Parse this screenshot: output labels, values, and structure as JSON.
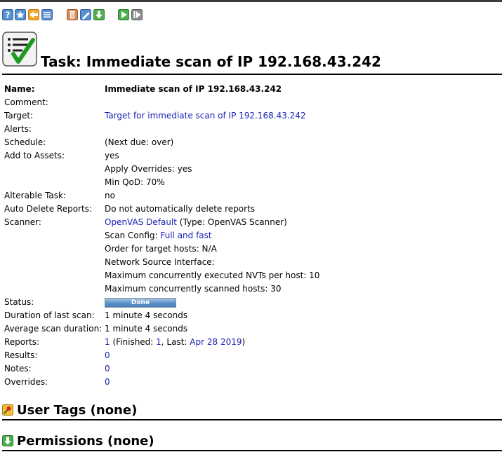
{
  "colors": {
    "link": "#1a22b4",
    "progress": "#5b8fc7"
  },
  "toolbar": {
    "icons": [
      "help-icon",
      "new-task-wizard-icon",
      "back-to-tasks-icon",
      "list-icon",
      "trashcan-icon",
      "edit-icon",
      "export-icon",
      "start-icon",
      "resume-icon"
    ]
  },
  "title": "Task: Immediate scan of IP 192.168.43.242",
  "details": {
    "name_label": "Name:",
    "name_value": "Immediate scan of IP 192.168.43.242",
    "comment_label": "Comment:",
    "target_label": "Target:",
    "target_value": "Target for immediate scan of IP 192.168.43.242",
    "alerts_label": "Alerts:",
    "schedule_label": "Schedule:",
    "schedule_value": "(Next due: over)",
    "add_assets_label": "Add to Assets:",
    "add_assets_value": "yes",
    "apply_overrides": "Apply Overrides: yes",
    "min_qod": "Min QoD: 70%",
    "alterable_label": "Alterable Task:",
    "alterable_value": "no",
    "auto_delete_label": "Auto Delete Reports:",
    "auto_delete_value": "Do not automatically delete reports",
    "scanner_label": "Scanner:",
    "scanner_link": "OpenVAS Default",
    "scanner_type": " (Type: OpenVAS Scanner)",
    "scan_config_prefix": "Scan Config: ",
    "scan_config_link": "Full and fast",
    "order_hosts": "Order for target hosts: N/A",
    "network_iface": "Network Source Interface:",
    "max_nvts": "Maximum concurrently executed NVTs per host: 10",
    "max_hosts": "Maximum concurrently scanned hosts: 30",
    "status_label": "Status:",
    "status_value": "Done",
    "status_progress": 1.0,
    "duration_label": "Duration of last scan:",
    "duration_value": "1 minute 4 seconds",
    "avg_label": "Average scan duration:",
    "avg_value": "1 minute 4 seconds",
    "reports_label": "Reports:",
    "reports_count": "1",
    "reports_finished_prefix": " (Finished: ",
    "reports_finished": "1",
    "reports_last_prefix": ", Last: ",
    "reports_last": "Apr 28 2019",
    "reports_suffix": ")",
    "results_label": "Results:",
    "results_value": "0",
    "notes_label": "Notes:",
    "notes_value": "0",
    "overrides_label": "Overrides:",
    "overrides_value": "0"
  },
  "sections": {
    "user_tags": "User Tags (none)",
    "permissions": "Permissions (none)"
  }
}
